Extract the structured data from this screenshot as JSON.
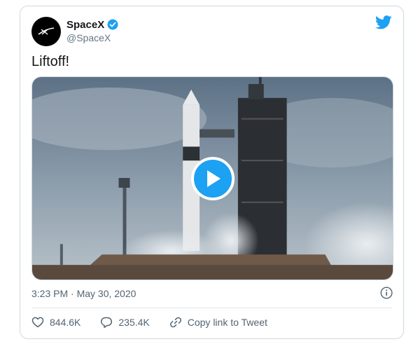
{
  "tweet": {
    "author": {
      "display_name": "SpaceX",
      "handle": "@SpaceX",
      "verified": true,
      "avatar_icon": "spacex-logo-icon"
    },
    "platform_icon": "twitter-bird-icon",
    "text": "Liftoff!",
    "media": {
      "type": "video",
      "play_icon": "play-icon"
    },
    "timestamp": "3:23 PM · May 30, 2020",
    "info_icon": "info-icon"
  },
  "actions": {
    "like": {
      "icon": "heart-icon",
      "count": "844.6K"
    },
    "reply": {
      "icon": "speech-bubble-icon",
      "count": "235.4K"
    },
    "copy_link": {
      "icon": "link-icon",
      "label": "Copy link to Tweet"
    }
  },
  "colors": {
    "accent": "#1da1f2",
    "text": "#14171a",
    "secondary": "#536471",
    "border": "#cfd9de"
  }
}
